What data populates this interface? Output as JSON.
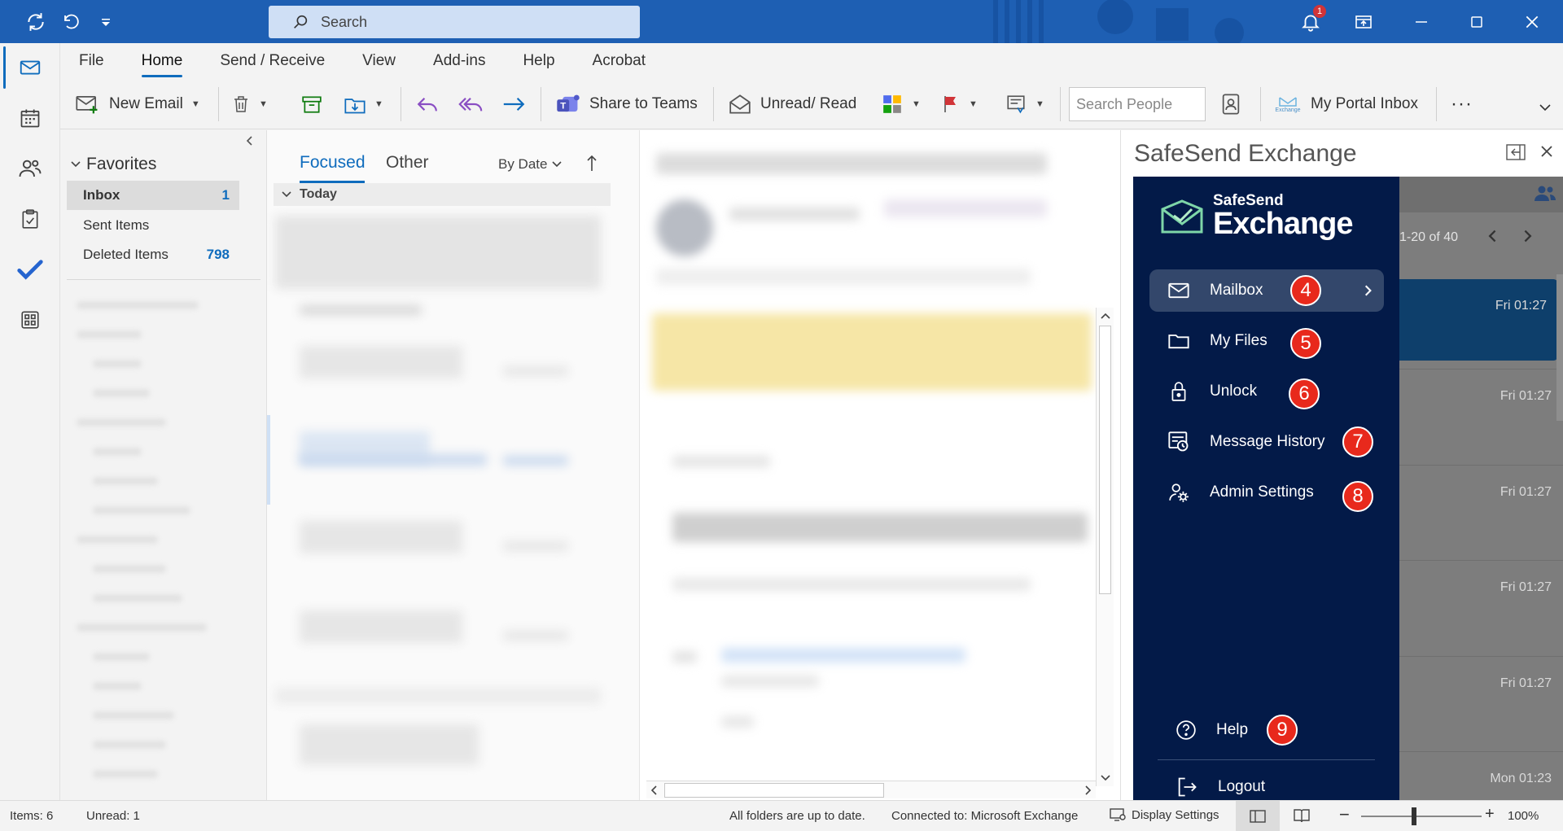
{
  "titlebar": {
    "search_placeholder": "Search",
    "notification_count": "1"
  },
  "ribbon": {
    "tabs": [
      "File",
      "Home",
      "Send / Receive",
      "View",
      "Add-ins",
      "Help",
      "Acrobat"
    ],
    "active_tab": "Home",
    "new_email": "New Email",
    "share_to_teams": "Share to Teams",
    "unread_read": "Unread/ Read",
    "search_people_placeholder": "Search People",
    "my_portal_inbox": "My Portal Inbox",
    "more": "···",
    "exchange_mini": "Exchange"
  },
  "folders": {
    "favorites": "Favorites",
    "items": [
      {
        "label": "Inbox",
        "count": "1"
      },
      {
        "label": "Sent Items",
        "count": ""
      },
      {
        "label": "Deleted Items",
        "count": "798"
      }
    ]
  },
  "message_list": {
    "tab_focused": "Focused",
    "tab_other": "Other",
    "sort": "By Date",
    "group_today": "Today"
  },
  "addin": {
    "title": "SafeSend Exchange",
    "logo_top": "SafeSend",
    "logo_bottom": "Exchange",
    "menu": [
      {
        "label": "Mailbox",
        "badge": "4"
      },
      {
        "label": "My Files",
        "badge": "5"
      },
      {
        "label": "Unlock",
        "badge": "6"
      },
      {
        "label": "Message History",
        "badge": "7"
      },
      {
        "label": "Admin Settings",
        "badge": "8"
      }
    ],
    "help": "Help",
    "help_badge": "9",
    "logout": "Logout",
    "pager": "1-20  of 40",
    "times": [
      "Fri 01:27",
      "Fri 01:27",
      "Fri 01:27",
      "Fri 01:27",
      "Fri 01:27",
      "Mon 01:23"
    ]
  },
  "status": {
    "items": "Items: 6",
    "unread": "Unread: 1",
    "sync": "All folders are up to date.",
    "connected": "Connected to: Microsoft Exchange",
    "display_settings": "Display Settings",
    "zoom": "100%"
  },
  "colors": {
    "titlebar": "#1e5fb3",
    "accent": "#0f6cbd",
    "safesend_panel": "#031a48",
    "badge": "#e8291c"
  }
}
